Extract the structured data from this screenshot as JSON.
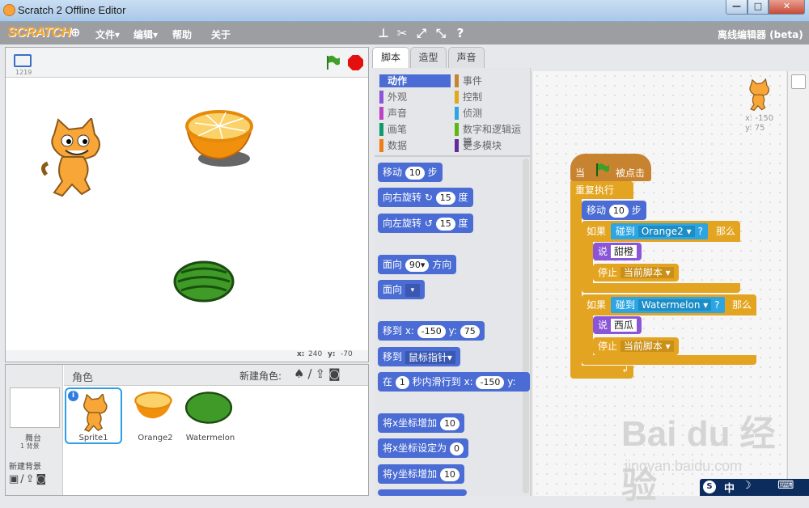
{
  "window": {
    "title": "Scratch 2 Offline Editor",
    "min": "—",
    "max": "□",
    "close": "✕"
  },
  "menu": {
    "logo": "SCRATCH",
    "file": "文件▾",
    "edit": "编辑▾",
    "help": "帮助",
    "about": "关于",
    "mode": "离线编辑器 (beta)"
  },
  "stage": {
    "version": "1219",
    "x_label": "x:",
    "x_val": "240",
    "y_label": "y:",
    "y_val": "-70"
  },
  "sprites": {
    "header": "角色",
    "new_sprite": "新建角色:",
    "stage_label": "舞台",
    "backdrops": "1 背景",
    "new_backdrop": "新建背景",
    "items": [
      {
        "name": "Sprite1"
      },
      {
        "name": "Orange2"
      },
      {
        "name": "Watermelon"
      }
    ]
  },
  "tabs": {
    "scripts": "脚本",
    "costumes": "造型",
    "sounds": "声音"
  },
  "categories": [
    {
      "label": "动作",
      "color": "#4a6cd4"
    },
    {
      "label": "事件",
      "color": "#c88330"
    },
    {
      "label": "外观",
      "color": "#8a55d7"
    },
    {
      "label": "控制",
      "color": "#e1a91a"
    },
    {
      "label": "声音",
      "color": "#bb42c3"
    },
    {
      "label": "侦测",
      "color": "#2ca5e2"
    },
    {
      "label": "画笔",
      "color": "#0e9a6c"
    },
    {
      "label": "数字和逻辑运算",
      "color": "#5cb712"
    },
    {
      "label": "数据",
      "color": "#ee7d16"
    },
    {
      "label": "更多模块",
      "color": "#632d99"
    }
  ],
  "palette": {
    "move": "移动",
    "move_n": "10",
    "steps": "步",
    "turn_right": "向右旋转",
    "turn_left": "向左旋转",
    "deg_n": "15",
    "deg": "度",
    "point_dir": "面向",
    "dir_n": "90▾",
    "dir_word": "方向",
    "point_towards": "面向",
    "towards_val": "▾",
    "goto_xy": "移到 x:",
    "gx": "-150",
    "y": "y:",
    "gy": "75",
    "goto": "移到",
    "mouse": "鼠标指针▾",
    "glide_in": "在",
    "glide_n": "1",
    "glide_mid": "秒内滑行到 x:",
    "glide_x": "-150",
    "glide_y": "y:",
    "change_x": "将x坐标增加",
    "cx": "10",
    "set_x": "将x坐标设定为",
    "sx": "0",
    "change_y": "将y坐标增加",
    "cy": "10"
  },
  "script": {
    "sprite_x": "x: -150",
    "sprite_y": "y: 75",
    "when": "当",
    "clicked": "被点击",
    "forever": "重复执行",
    "move": "移动",
    "move_n": "10",
    "steps": "步",
    "if": "如果",
    "touching": "碰到",
    "then": "那么",
    "q": "?",
    "target1": "Orange2 ▾",
    "say": "说",
    "say1": "甜橙",
    "stop": "停止",
    "stop_opt": "当前脚本 ▾",
    "target2": "Watermelon ▾",
    "say2": "西瓜"
  },
  "watermark": {
    "brand": "Bai du 经验",
    "url": "jingyan.baidu.com"
  },
  "ime": {
    "a": "中",
    "b": "☽",
    "c": "⌨"
  }
}
